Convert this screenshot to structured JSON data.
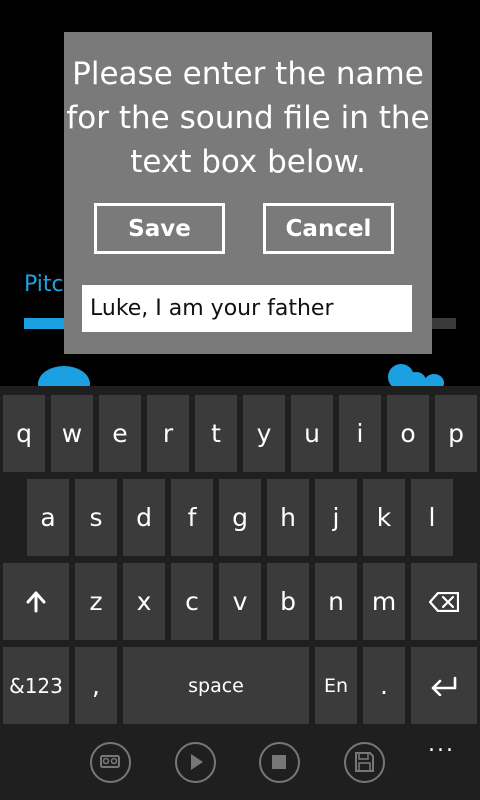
{
  "background": {
    "label": "Pitc",
    "slider_level": 0.27
  },
  "dialog": {
    "message_lines": [
      "Please enter the name",
      "for the sound file in the",
      "text box below."
    ],
    "save_label": "Save",
    "cancel_label": "Cancel",
    "input_value": "Luke, I am your father"
  },
  "keyboard": {
    "row1": [
      "q",
      "w",
      "e",
      "r",
      "t",
      "y",
      "u",
      "i",
      "o",
      "p"
    ],
    "row2": [
      "a",
      "s",
      "d",
      "f",
      "g",
      "h",
      "j",
      "k",
      "l"
    ],
    "row3": [
      "z",
      "x",
      "c",
      "v",
      "b",
      "n",
      "m"
    ],
    "symbols_label": "&123",
    "comma_label": ",",
    "space_label": "space",
    "lang_label": "En",
    "period_label": "."
  },
  "appbar": {
    "icons": [
      "voicemail-icon",
      "play-icon",
      "stop-icon",
      "save-icon"
    ],
    "more_label": "..."
  },
  "colors": {
    "accent": "#1ba1e2",
    "dialog": "#7a7a7a",
    "key": "#3b3b3b"
  }
}
